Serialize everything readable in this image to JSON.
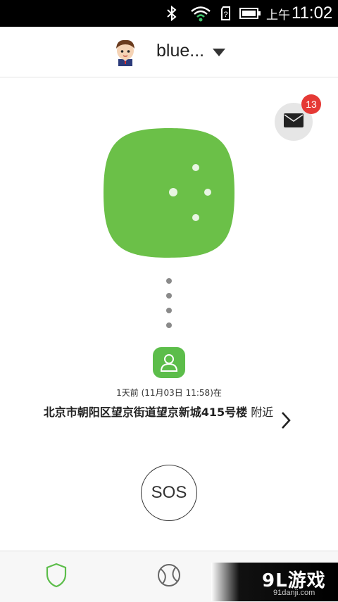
{
  "status_bar": {
    "icons": [
      "bluetooth-icon",
      "wifi-icon",
      "sim-icon",
      "battery-icon"
    ],
    "ampm": "上午",
    "time": "11:02"
  },
  "header": {
    "username": "blue...",
    "avatar": "child-avatar"
  },
  "mail": {
    "icon": "mail-icon",
    "badge_count": "13"
  },
  "device": {
    "icon": "device-blob-icon",
    "color": "#6bc048"
  },
  "location": {
    "time_info": "1天前 (11月03日 11:58)在",
    "address_bold": "北京市朝阳区望京街道望京新城415号楼",
    "address_suffix": "附近"
  },
  "sos": {
    "label": "SOS"
  },
  "bottom_nav": {
    "items": [
      {
        "icon": "shield-icon",
        "active_color": "#5cbd4a"
      },
      {
        "icon": "ball-icon"
      }
    ]
  },
  "watermark": {
    "logo": "9L游戏",
    "url": "91danji.com"
  }
}
